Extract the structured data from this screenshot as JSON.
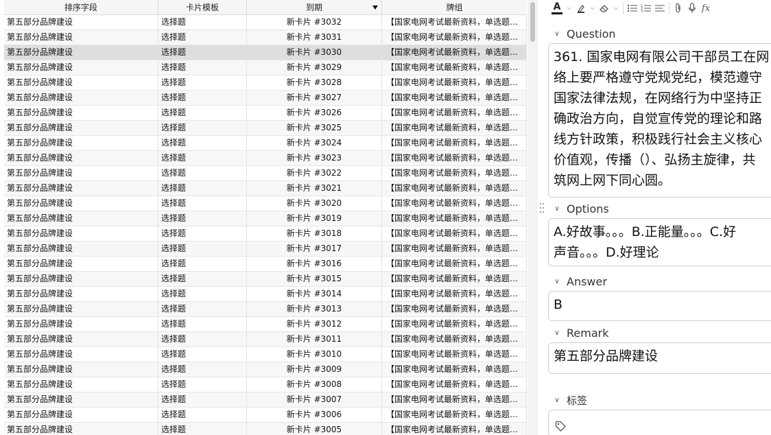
{
  "table": {
    "columns": [
      "排序字段",
      "卡片模板",
      "到期",
      "牌组"
    ],
    "sorted_column": "到期",
    "selected_index": 2,
    "rows": [
      {
        "sort_field": "第五部分品牌建设",
        "template": "选择题",
        "due": "新卡片 #3032",
        "deck": "【国家电网考试最新资料，单选题】..."
      },
      {
        "sort_field": "第五部分品牌建设",
        "template": "选择题",
        "due": "新卡片 #3031",
        "deck": "【国家电网考试最新资料，单选题】..."
      },
      {
        "sort_field": "第五部分品牌建设",
        "template": "选择题",
        "due": "新卡片 #3030",
        "deck": "【国家电网考试最新资料，单选题】..."
      },
      {
        "sort_field": "第五部分品牌建设",
        "template": "选择题",
        "due": "新卡片 #3029",
        "deck": "【国家电网考试最新资料，单选题】..."
      },
      {
        "sort_field": "第五部分品牌建设",
        "template": "选择题",
        "due": "新卡片 #3028",
        "deck": "【国家电网考试最新资料，单选题】..."
      },
      {
        "sort_field": "第五部分品牌建设",
        "template": "选择题",
        "due": "新卡片 #3027",
        "deck": "【国家电网考试最新资料，单选题】..."
      },
      {
        "sort_field": "第五部分品牌建设",
        "template": "选择题",
        "due": "新卡片 #3026",
        "deck": "【国家电网考试最新资料，单选题】..."
      },
      {
        "sort_field": "第五部分品牌建设",
        "template": "选择题",
        "due": "新卡片 #3025",
        "deck": "【国家电网考试最新资料，单选题】..."
      },
      {
        "sort_field": "第五部分品牌建设",
        "template": "选择题",
        "due": "新卡片 #3024",
        "deck": "【国家电网考试最新资料，单选题】..."
      },
      {
        "sort_field": "第五部分品牌建设",
        "template": "选择题",
        "due": "新卡片 #3023",
        "deck": "【国家电网考试最新资料，单选题】..."
      },
      {
        "sort_field": "第五部分品牌建设",
        "template": "选择题",
        "due": "新卡片 #3022",
        "deck": "【国家电网考试最新资料，单选题】..."
      },
      {
        "sort_field": "第五部分品牌建设",
        "template": "选择题",
        "due": "新卡片 #3021",
        "deck": "【国家电网考试最新资料，单选题】..."
      },
      {
        "sort_field": "第五部分品牌建设",
        "template": "选择题",
        "due": "新卡片 #3020",
        "deck": "【国家电网考试最新资料，单选题】..."
      },
      {
        "sort_field": "第五部分品牌建设",
        "template": "选择题",
        "due": "新卡片 #3019",
        "deck": "【国家电网考试最新资料，单选题】..."
      },
      {
        "sort_field": "第五部分品牌建设",
        "template": "选择题",
        "due": "新卡片 #3018",
        "deck": "【国家电网考试最新资料，单选题】..."
      },
      {
        "sort_field": "第五部分品牌建设",
        "template": "选择题",
        "due": "新卡片 #3017",
        "deck": "【国家电网考试最新资料，单选题】..."
      },
      {
        "sort_field": "第五部分品牌建设",
        "template": "选择题",
        "due": "新卡片 #3016",
        "deck": "【国家电网考试最新资料，单选题】..."
      },
      {
        "sort_field": "第五部分品牌建设",
        "template": "选择题",
        "due": "新卡片 #3015",
        "deck": "【国家电网考试最新资料，单选题】..."
      },
      {
        "sort_field": "第五部分品牌建设",
        "template": "选择题",
        "due": "新卡片 #3014",
        "deck": "【国家电网考试最新资料，单选题】..."
      },
      {
        "sort_field": "第五部分品牌建设",
        "template": "选择题",
        "due": "新卡片 #3013",
        "deck": "【国家电网考试最新资料，单选题】..."
      },
      {
        "sort_field": "第五部分品牌建设",
        "template": "选择题",
        "due": "新卡片 #3012",
        "deck": "【国家电网考试最新资料，单选题】..."
      },
      {
        "sort_field": "第五部分品牌建设",
        "template": "选择题",
        "due": "新卡片 #3011",
        "deck": "【国家电网考试最新资料，单选题】..."
      },
      {
        "sort_field": "第五部分品牌建设",
        "template": "选择题",
        "due": "新卡片 #3010",
        "deck": "【国家电网考试最新资料，单选题】..."
      },
      {
        "sort_field": "第五部分品牌建设",
        "template": "选择题",
        "due": "新卡片 #3009",
        "deck": "【国家电网考试最新资料，单选题】..."
      },
      {
        "sort_field": "第五部分品牌建设",
        "template": "选择题",
        "due": "新卡片 #3008",
        "deck": "【国家电网考试最新资料，单选题】..."
      },
      {
        "sort_field": "第五部分品牌建设",
        "template": "选择题",
        "due": "新卡片 #3007",
        "deck": "【国家电网考试最新资料，单选题】..."
      },
      {
        "sort_field": "第五部分品牌建设",
        "template": "选择题",
        "due": "新卡片 #3006",
        "deck": "【国家电网考试最新资料，单选题】..."
      },
      {
        "sort_field": "第五部分品牌建设",
        "template": "选择题",
        "due": "新卡片 #3005",
        "deck": "【国家电网考试最新资料，单选题】..."
      }
    ]
  },
  "toolbar": {
    "icons": [
      "text-color-icon",
      "chevron-down-icon",
      "highlight-icon",
      "chevron-down-icon",
      "eraser-icon",
      "chevron-down-icon",
      "bullet-list-icon",
      "numbered-list-icon",
      "align-icon",
      "attachment-icon",
      "microphone-icon",
      "formula-icon"
    ],
    "formula_label": "fx"
  },
  "editor": {
    "fields": {
      "question": {
        "label": "Question",
        "lines": [
          "361. 国家电网有限公司干部员工在网",
          "络上要严格遵守党规党纪，模范遵守",
          "国家法律法规，在网络行为中坚持正",
          "确政治方向，自觉宣传党的理论和路",
          "线方针政策，积极践行社会主义核心",
          "价值观，传播（）、弘扬主旋律，共",
          "筑网上网下同心圆。"
        ]
      },
      "options": {
        "label": "Options",
        "lines": [
          "A.好故事。。。B.正能量。。。C.好",
          "声音。。。D.好理论"
        ]
      },
      "answer": {
        "label": "Answer",
        "value": "B"
      },
      "remark": {
        "label": "Remark",
        "value": "第五部分品牌建设"
      },
      "tags": {
        "label": "标签",
        "value": ""
      }
    }
  },
  "colors": {
    "selected_row": "#dedede",
    "header_bg": "#f6f6f6",
    "field_border": "#cfcfcf"
  }
}
